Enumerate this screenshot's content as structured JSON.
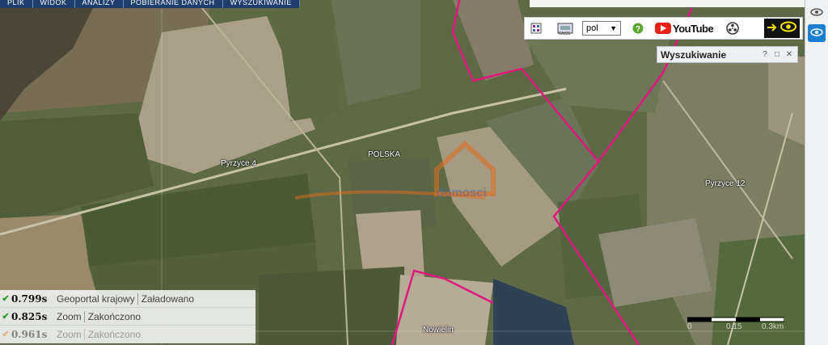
{
  "menu": [
    "PLIK",
    "WIDOK",
    "ANALIZY",
    "POBIERANIE DANYCH",
    "WYSZUKIWANIE"
  ],
  "toolbar": {
    "language": "pol",
    "youtube_label": "YouTube",
    "icons": [
      "layers-icon",
      "gnss-icon",
      "help-icon",
      "youtube-icon",
      "reel-icon",
      "eye-icon"
    ]
  },
  "search_panel": {
    "title": "Wyszukiwanie",
    "buttons": [
      "?",
      "□",
      "✕"
    ]
  },
  "map_labels": {
    "pyrzyce4": "Pyrzyce 4",
    "polska": "POLSKA",
    "pyrzyce12": "Pyrzyce 12",
    "nowielin": "Nowielin",
    "watermark": "domosci"
  },
  "scale": {
    "labels": [
      "0",
      "0.15",
      "0.3km"
    ]
  },
  "status_rows": [
    {
      "time": "0.799s",
      "name": "Geoportal krajowy",
      "state": "Załadowano",
      "check_color": "#2c9a2c"
    },
    {
      "time": "0.825s",
      "name": "Zoom",
      "state": "Zakończono",
      "check_color": "#2c9a2c"
    },
    {
      "time": "0.961s",
      "name": "Zoom",
      "state": "Zakończono",
      "check_color": "#e46b1a"
    }
  ],
  "colors": {
    "boundary": "#e0187d",
    "accent_blue": "#1e3f6e"
  }
}
